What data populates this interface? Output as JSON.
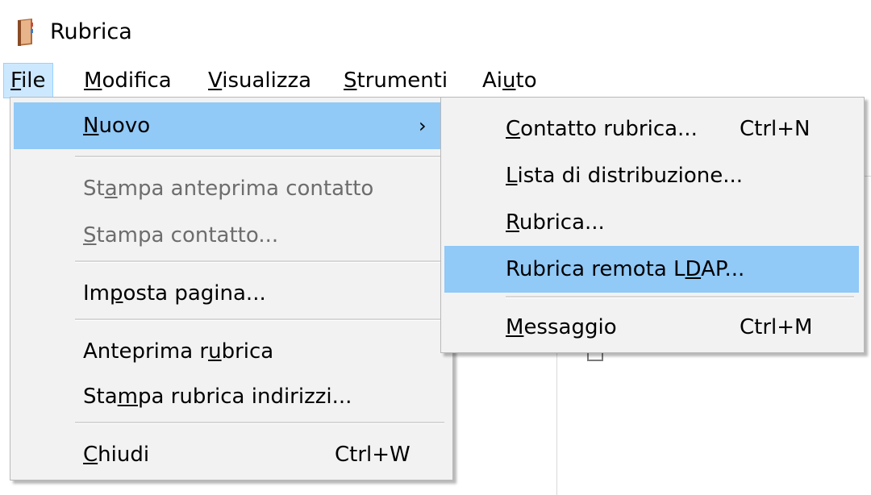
{
  "window": {
    "title": "Rubrica",
    "icon": "address-book-icon"
  },
  "menubar": {
    "items": [
      {
        "label_pre": "",
        "label_acc": "F",
        "label_post": "ile"
      },
      {
        "label_pre": "",
        "label_acc": "M",
        "label_post": "odifica"
      },
      {
        "label_pre": "",
        "label_acc": "V",
        "label_post": "isualizza"
      },
      {
        "label_pre": "",
        "label_acc": "S",
        "label_post": "trumenti"
      },
      {
        "label_pre": "Ai",
        "label_acc": "u",
        "label_post": "to"
      }
    ]
  },
  "file_menu": {
    "nuovo": {
      "pre": "",
      "acc": "N",
      "post": "uovo",
      "arrow": "›"
    },
    "stampa_anteprima_contatto": {
      "pre": "St",
      "acc": "a",
      "post": "mpa anteprima contatto"
    },
    "stampa_contatto": {
      "pre": "",
      "acc": "S",
      "post": "tampa contatto..."
    },
    "imposta_pagina": {
      "pre": "Im",
      "acc": "p",
      "post": "osta pagina..."
    },
    "anteprima_rubrica": {
      "pre": "Anteprima r",
      "acc": "u",
      "post": "brica"
    },
    "stampa_rubrica_indirizzi": {
      "pre": "Sta",
      "acc": "m",
      "post": "pa rubrica indirizzi..."
    },
    "chiudi": {
      "pre": "",
      "acc": "C",
      "post": "hiudi",
      "shortcut": "Ctrl+W"
    }
  },
  "submenu": {
    "contatto_rubrica": {
      "pre": "",
      "acc": "C",
      "post": "ontatto rubrica...",
      "shortcut": "Ctrl+N"
    },
    "lista_distribuzione": {
      "pre": "",
      "acc": "L",
      "post": "ista di distribuzione..."
    },
    "rubrica": {
      "pre": "",
      "acc": "R",
      "post": "ubrica..."
    },
    "rubrica_remota_ldap": {
      "pre": "Rubrica remota L",
      "acc": "D",
      "post": "AP..."
    },
    "messaggio": {
      "pre": "",
      "acc": "M",
      "post": "essaggio",
      "shortcut": "Ctrl+M"
    }
  },
  "colors": {
    "highlight": "#91c9f7",
    "menu_background": "#f2f2f2",
    "disabled_text": "#6d6d6d"
  }
}
